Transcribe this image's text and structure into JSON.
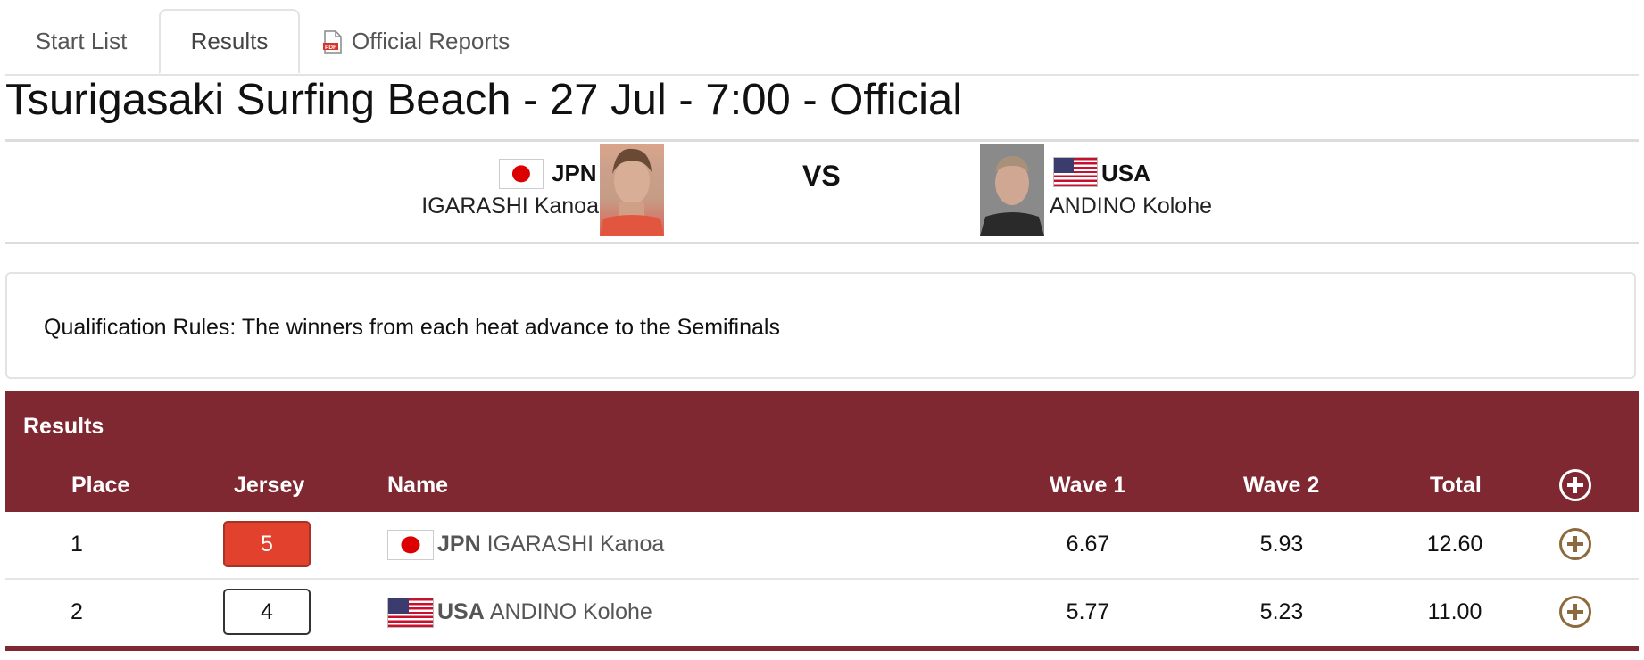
{
  "tabs": [
    {
      "label": "Start List"
    },
    {
      "label": "Results"
    },
    {
      "label": "Official Reports"
    }
  ],
  "page_title": "Tsurigasaki Surfing Beach - 27 Jul - 7:00 - Official",
  "matchup": {
    "athlete1": {
      "country": "JPN",
      "name": "IGARASHI Kanoa",
      "flag": "japan-flag"
    },
    "vs": "VS",
    "athlete2": {
      "country": "USA",
      "name": "ANDINO Kolohe",
      "flag": "usa-flag"
    }
  },
  "qualification_rules": "Qualification Rules: The winners from each heat advance to the Semifinals",
  "results": {
    "title": "Results",
    "columns": [
      "Place",
      "Jersey",
      "Name",
      "Wave 1",
      "Wave 2",
      "Total"
    ],
    "rows": [
      {
        "place": "1",
        "jersey": "5",
        "jersey_color": "#e2412d",
        "country": "JPN",
        "name": "IGARASHI Kanoa",
        "wave1": "6.67",
        "wave2": "5.93",
        "total": "12.60"
      },
      {
        "place": "2",
        "jersey": "4",
        "jersey_color": "#ffffff",
        "country": "USA",
        "name": "ANDINO Kolohe",
        "wave1": "5.77",
        "wave2": "5.23",
        "total": "11.00"
      }
    ]
  },
  "colors": {
    "header_bg": "#7f2832",
    "expand_icon": "#8c6a3d"
  }
}
